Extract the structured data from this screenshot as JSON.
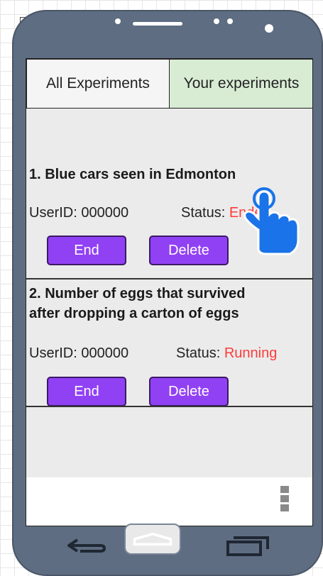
{
  "tabs": {
    "all_label": "All Experiments",
    "yours_label": "Your experiments"
  },
  "experiments": [
    {
      "title_lines": [
        "1. Blue cars seen in Edmonton"
      ],
      "userid": "UserID: 000000",
      "status_label": "Status:",
      "status_value": "Ended",
      "end_label": "End",
      "delete_label": "Delete"
    },
    {
      "title_lines": [
        "2. Number of eggs that survived",
        "after dropping a carton of eggs"
      ],
      "userid": "UserID: 000000",
      "status_label": "Status:",
      "status_value": "Running",
      "end_label": "End",
      "delete_label": "Delete"
    }
  ],
  "colors": {
    "phone_body": "#5e6d81",
    "button_purple": "#9141f4",
    "status_red": "#ff3b3b",
    "tab_active_green": "#d8ecd4",
    "hand_cursor_blue": "#1a73e8"
  },
  "icons": [
    "collapse-icon",
    "pointer-hand-icon",
    "overflow-menu-icon",
    "back-icon",
    "home-icon",
    "recent-apps-icon"
  ]
}
